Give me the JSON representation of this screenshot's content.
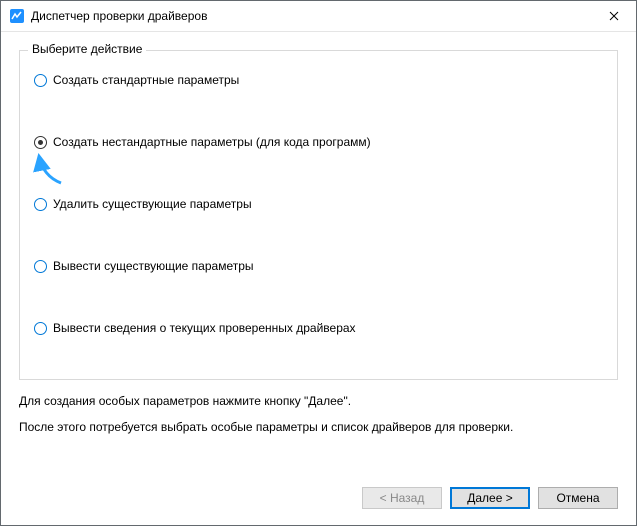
{
  "window": {
    "title": "Диспетчер проверки драйверов"
  },
  "group": {
    "legend": "Выберите действие",
    "options": [
      {
        "label": "Создать стандартные параметры",
        "selected": false
      },
      {
        "label": "Создать нестандартные параметры (для кода программ)",
        "selected": true
      },
      {
        "label": "Удалить существующие параметры",
        "selected": false
      },
      {
        "label": "Вывести существующие параметры",
        "selected": false
      },
      {
        "label": "Вывести сведения о текущих проверенных драйверах",
        "selected": false
      }
    ]
  },
  "info": {
    "line1": "Для создания особых параметров нажмите кнопку \"Далее\".",
    "line2": "После этого потребуется выбрать особые параметры и список драйверов для проверки."
  },
  "buttons": {
    "back": "< Назад",
    "next": "Далее >",
    "cancel": "Отмена"
  },
  "icons": {
    "app": "app-icon",
    "close": "close-icon"
  },
  "annotation": {
    "arrow_color": "#2aa3ff"
  }
}
